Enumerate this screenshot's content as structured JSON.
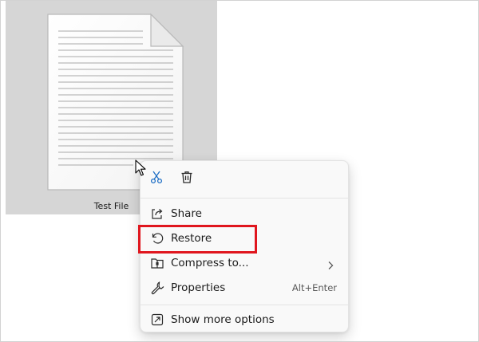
{
  "file": {
    "name": "Test File",
    "icon": "document-icon"
  },
  "context_menu": {
    "quick_actions": [
      {
        "name": "cut",
        "icon": "scissors-icon"
      },
      {
        "name": "delete",
        "icon": "trash-icon"
      }
    ],
    "items": [
      {
        "label": "Share",
        "icon": "share-icon",
        "shortcut": ""
      },
      {
        "label": "Restore",
        "icon": "undo-icon",
        "shortcut": ""
      },
      {
        "label": "Compress to...",
        "icon": "zip-folder-icon",
        "shortcut": "",
        "has_submenu": true
      },
      {
        "label": "Properties",
        "icon": "wrench-icon",
        "shortcut": "Alt+Enter"
      }
    ],
    "footer_item": {
      "label": "Show more options",
      "icon": "external-window-icon"
    }
  },
  "annotation": {
    "highlighted_item": "Restore",
    "color": "#e0161e"
  },
  "colors": {
    "selection_background": "#d6d6d6",
    "menu_background": "#f9f9f9",
    "icon_accent": "#1f6fc5"
  }
}
